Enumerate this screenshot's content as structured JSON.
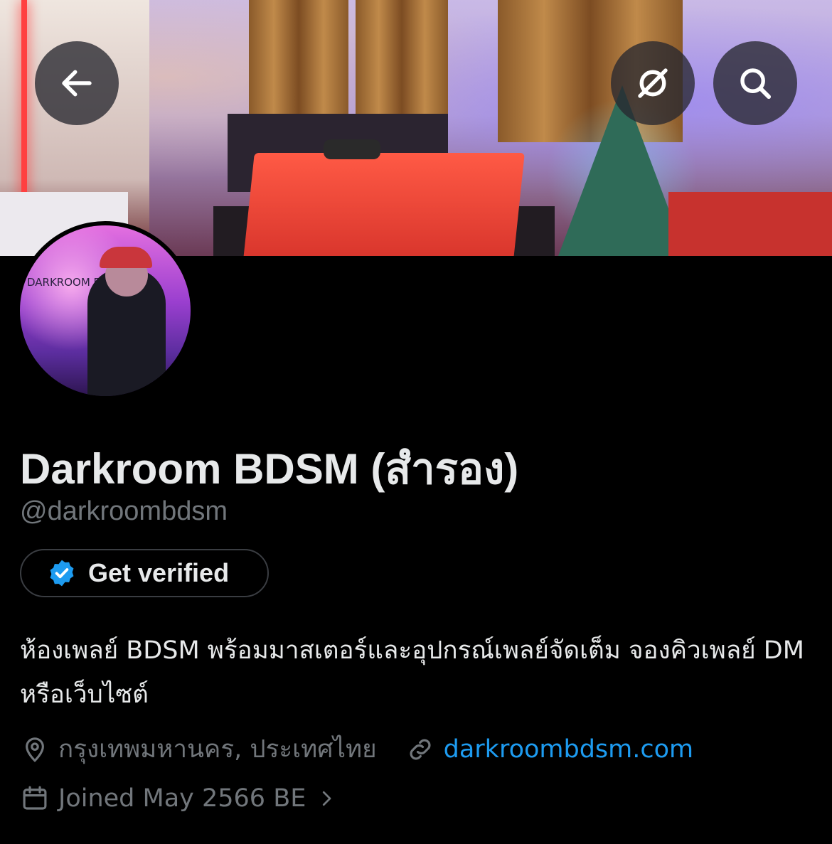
{
  "header": {
    "back_icon": "arrow-left-icon",
    "tools_icons": [
      "grok-icon",
      "search-icon"
    ]
  },
  "profile": {
    "display_name": "Darkroom BDSM (สำรอง)",
    "handle": "@darkroombdsm",
    "get_verified_label": "Get verified",
    "verified_badge_color": "#1d9bf0",
    "bio": "ห้องเพลย์ BDSM พร้อมมาสเตอร์และอุปกรณ์เพลย์จัดเต็ม จองคิวเพลย์ DM หรือเว็บไซต์",
    "location": "กรุงเทพมหานคร, ประเทศไทย",
    "website": "darkroombdsm.com",
    "joined": "Joined May 2566 BE"
  },
  "avatar": {
    "sign_text": "DARKROOM BDSM"
  },
  "colors": {
    "background": "#000000",
    "primary_text": "#e7e9ea",
    "secondary_text": "#71767b",
    "link": "#1d9bf0"
  }
}
